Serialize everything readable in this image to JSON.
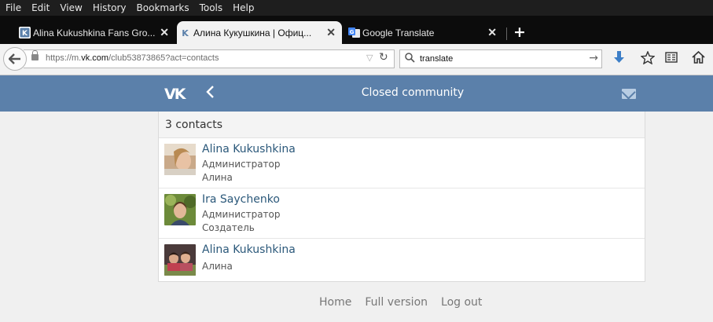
{
  "menu": [
    "File",
    "Edit",
    "View",
    "History",
    "Bookmarks",
    "Tools",
    "Help"
  ],
  "tabs": [
    {
      "label": "Alina Kukushkina Fans Gro...",
      "icon": "vk-icon"
    },
    {
      "label": "Алина Кукушкина | Офиц...",
      "icon": "vk-icon"
    },
    {
      "label": "Google Translate",
      "icon": "google-translate-icon"
    }
  ],
  "tab_close": "✕",
  "new_tab": "+",
  "nav": {
    "url_prefix": "https://m.",
    "url_domain": "vk.com",
    "url_path": "/club53873865?act=contacts",
    "search_value": "translate"
  },
  "vk": {
    "logo": "VK",
    "title": "Closed community"
  },
  "contacts_count": "3 contacts",
  "contacts": [
    {
      "name": "Alina Kukushkina",
      "role": "Администратор",
      "note": "Алина"
    },
    {
      "name": "Ira Saychenko",
      "role": "Администратор",
      "note": "Создатель"
    },
    {
      "name": "Alina Kukushkina",
      "role": "",
      "note": "Алина"
    }
  ],
  "footer": [
    "Home",
    "Full version",
    "Log out"
  ],
  "colors": {
    "vk_header": "#5b80aa",
    "link": "#2b587a"
  }
}
